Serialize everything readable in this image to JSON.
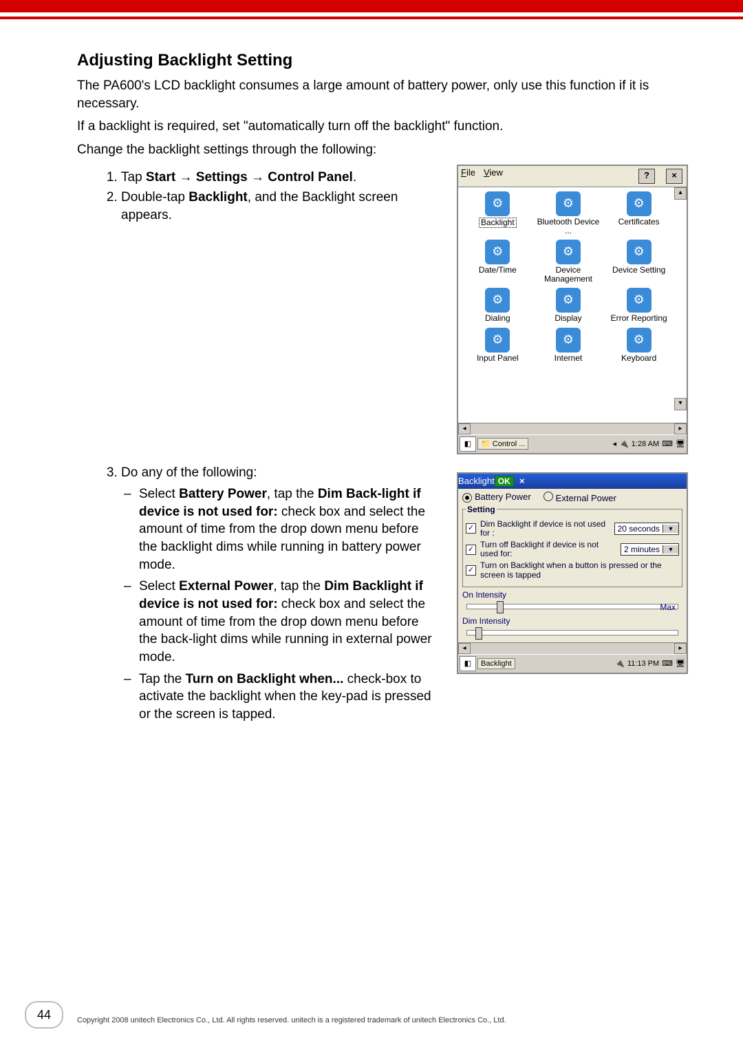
{
  "page_number": "44",
  "copyright": "Copyright 2008 unitech Electronics Co., Ltd. All rights reserved. unitech is a registered trademark of unitech Electronics Co., Ltd.",
  "heading": "Adjusting Backlight Setting",
  "para1": "The PA600's LCD backlight consumes a large amount of battery power, only use this function if it is necessary.",
  "para2": "If a backlight is required, set \"automatically turn off the backlight\" function.",
  "para3": "Change the backlight settings through the following:",
  "step1_pre": "Tap ",
  "step1_b1": "Start",
  "step1_arrow": " → ",
  "step1_b2": "Settings",
  "step1_b3": "Control Panel",
  "step1_end": ".",
  "step2_pre": "Double-tap ",
  "step2_b": "Backlight",
  "step2_post": ", and the Backlight screen appears.",
  "step3": "Do any of the following:",
  "b1_pre": "Select ",
  "b1_b1": "Battery Power",
  "b1_mid": ", tap the ",
  "b1_b2": "Dim Back-light if device is not used for:",
  "b1_post": " check box and select the amount of time from the drop down menu before the backlight dims while running in battery power mode.",
  "b2_pre": "Select ",
  "b2_b1": "External Power",
  "b2_mid": ", tap the ",
  "b2_b2": "Dim Backlight if device is not used for:",
  "b2_post": " check box and select the amount of time from the drop down menu before the back-light dims while running in external power mode.",
  "b3_pre": "Tap the ",
  "b3_b": "Turn on Backlight when...",
  "b3_post": " check-box to activate the backlight when the key-pad is pressed or the screen is tapped.",
  "cp": {
    "menu_file": "File",
    "menu_view": "View",
    "help": "?",
    "close": "×",
    "icons": [
      {
        "l": "Backlight",
        "sel": true
      },
      {
        "l": "Bluetooth Device ..."
      },
      {
        "l": "Certificates"
      },
      {
        "l": "Date/Time"
      },
      {
        "l": "Device Management"
      },
      {
        "l": "Device Setting"
      },
      {
        "l": "Dialing"
      },
      {
        "l": "Display"
      },
      {
        "l": "Error Reporting"
      },
      {
        "l": "Input Panel"
      },
      {
        "l": "Internet"
      },
      {
        "l": "Keyboard"
      }
    ],
    "task": "Control ...",
    "time": "1:28 AM"
  },
  "bl": {
    "title": "Backlight",
    "ok": "OK",
    "close": "×",
    "r_battery": "Battery Power",
    "r_external": "External Power",
    "legend": "Setting",
    "opt1": "Dim Backlight if device is not used for :",
    "dd1": "20 seconds",
    "opt2": "Turn off Backlight if device is not used for:",
    "dd2": "2 minutes",
    "opt3": "Turn on Backlight when a button is pressed or the screen is tapped",
    "on_int": "On Intensity",
    "dim_int": "Dim Intensity",
    "max": "Max",
    "task": "Backlight",
    "time": "11:13 PM"
  }
}
